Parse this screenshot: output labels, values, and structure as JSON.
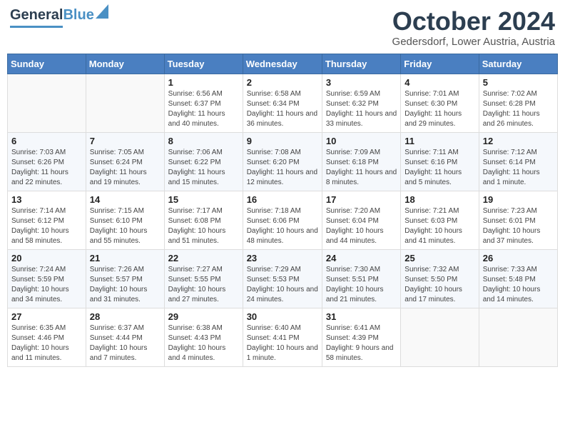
{
  "header": {
    "logo_general": "General",
    "logo_blue": "Blue",
    "month_title": "October 2024",
    "location": "Gedersdorf, Lower Austria, Austria"
  },
  "days_of_week": [
    "Sunday",
    "Monday",
    "Tuesday",
    "Wednesday",
    "Thursday",
    "Friday",
    "Saturday"
  ],
  "weeks": [
    [
      {
        "day": "",
        "sunrise": "",
        "sunset": "",
        "daylight": ""
      },
      {
        "day": "",
        "sunrise": "",
        "sunset": "",
        "daylight": ""
      },
      {
        "day": "1",
        "sunrise": "Sunrise: 6:56 AM",
        "sunset": "Sunset: 6:37 PM",
        "daylight": "Daylight: 11 hours and 40 minutes."
      },
      {
        "day": "2",
        "sunrise": "Sunrise: 6:58 AM",
        "sunset": "Sunset: 6:34 PM",
        "daylight": "Daylight: 11 hours and 36 minutes."
      },
      {
        "day": "3",
        "sunrise": "Sunrise: 6:59 AM",
        "sunset": "Sunset: 6:32 PM",
        "daylight": "Daylight: 11 hours and 33 minutes."
      },
      {
        "day": "4",
        "sunrise": "Sunrise: 7:01 AM",
        "sunset": "Sunset: 6:30 PM",
        "daylight": "Daylight: 11 hours and 29 minutes."
      },
      {
        "day": "5",
        "sunrise": "Sunrise: 7:02 AM",
        "sunset": "Sunset: 6:28 PM",
        "daylight": "Daylight: 11 hours and 26 minutes."
      }
    ],
    [
      {
        "day": "6",
        "sunrise": "Sunrise: 7:03 AM",
        "sunset": "Sunset: 6:26 PM",
        "daylight": "Daylight: 11 hours and 22 minutes."
      },
      {
        "day": "7",
        "sunrise": "Sunrise: 7:05 AM",
        "sunset": "Sunset: 6:24 PM",
        "daylight": "Daylight: 11 hours and 19 minutes."
      },
      {
        "day": "8",
        "sunrise": "Sunrise: 7:06 AM",
        "sunset": "Sunset: 6:22 PM",
        "daylight": "Daylight: 11 hours and 15 minutes."
      },
      {
        "day": "9",
        "sunrise": "Sunrise: 7:08 AM",
        "sunset": "Sunset: 6:20 PM",
        "daylight": "Daylight: 11 hours and 12 minutes."
      },
      {
        "day": "10",
        "sunrise": "Sunrise: 7:09 AM",
        "sunset": "Sunset: 6:18 PM",
        "daylight": "Daylight: 11 hours and 8 minutes."
      },
      {
        "day": "11",
        "sunrise": "Sunrise: 7:11 AM",
        "sunset": "Sunset: 6:16 PM",
        "daylight": "Daylight: 11 hours and 5 minutes."
      },
      {
        "day": "12",
        "sunrise": "Sunrise: 7:12 AM",
        "sunset": "Sunset: 6:14 PM",
        "daylight": "Daylight: 11 hours and 1 minute."
      }
    ],
    [
      {
        "day": "13",
        "sunrise": "Sunrise: 7:14 AM",
        "sunset": "Sunset: 6:12 PM",
        "daylight": "Daylight: 10 hours and 58 minutes."
      },
      {
        "day": "14",
        "sunrise": "Sunrise: 7:15 AM",
        "sunset": "Sunset: 6:10 PM",
        "daylight": "Daylight: 10 hours and 55 minutes."
      },
      {
        "day": "15",
        "sunrise": "Sunrise: 7:17 AM",
        "sunset": "Sunset: 6:08 PM",
        "daylight": "Daylight: 10 hours and 51 minutes."
      },
      {
        "day": "16",
        "sunrise": "Sunrise: 7:18 AM",
        "sunset": "Sunset: 6:06 PM",
        "daylight": "Daylight: 10 hours and 48 minutes."
      },
      {
        "day": "17",
        "sunrise": "Sunrise: 7:20 AM",
        "sunset": "Sunset: 6:04 PM",
        "daylight": "Daylight: 10 hours and 44 minutes."
      },
      {
        "day": "18",
        "sunrise": "Sunrise: 7:21 AM",
        "sunset": "Sunset: 6:03 PM",
        "daylight": "Daylight: 10 hours and 41 minutes."
      },
      {
        "day": "19",
        "sunrise": "Sunrise: 7:23 AM",
        "sunset": "Sunset: 6:01 PM",
        "daylight": "Daylight: 10 hours and 37 minutes."
      }
    ],
    [
      {
        "day": "20",
        "sunrise": "Sunrise: 7:24 AM",
        "sunset": "Sunset: 5:59 PM",
        "daylight": "Daylight: 10 hours and 34 minutes."
      },
      {
        "day": "21",
        "sunrise": "Sunrise: 7:26 AM",
        "sunset": "Sunset: 5:57 PM",
        "daylight": "Daylight: 10 hours and 31 minutes."
      },
      {
        "day": "22",
        "sunrise": "Sunrise: 7:27 AM",
        "sunset": "Sunset: 5:55 PM",
        "daylight": "Daylight: 10 hours and 27 minutes."
      },
      {
        "day": "23",
        "sunrise": "Sunrise: 7:29 AM",
        "sunset": "Sunset: 5:53 PM",
        "daylight": "Daylight: 10 hours and 24 minutes."
      },
      {
        "day": "24",
        "sunrise": "Sunrise: 7:30 AM",
        "sunset": "Sunset: 5:51 PM",
        "daylight": "Daylight: 10 hours and 21 minutes."
      },
      {
        "day": "25",
        "sunrise": "Sunrise: 7:32 AM",
        "sunset": "Sunset: 5:50 PM",
        "daylight": "Daylight: 10 hours and 17 minutes."
      },
      {
        "day": "26",
        "sunrise": "Sunrise: 7:33 AM",
        "sunset": "Sunset: 5:48 PM",
        "daylight": "Daylight: 10 hours and 14 minutes."
      }
    ],
    [
      {
        "day": "27",
        "sunrise": "Sunrise: 6:35 AM",
        "sunset": "Sunset: 4:46 PM",
        "daylight": "Daylight: 10 hours and 11 minutes."
      },
      {
        "day": "28",
        "sunrise": "Sunrise: 6:37 AM",
        "sunset": "Sunset: 4:44 PM",
        "daylight": "Daylight: 10 hours and 7 minutes."
      },
      {
        "day": "29",
        "sunrise": "Sunrise: 6:38 AM",
        "sunset": "Sunset: 4:43 PM",
        "daylight": "Daylight: 10 hours and 4 minutes."
      },
      {
        "day": "30",
        "sunrise": "Sunrise: 6:40 AM",
        "sunset": "Sunset: 4:41 PM",
        "daylight": "Daylight: 10 hours and 1 minute."
      },
      {
        "day": "31",
        "sunrise": "Sunrise: 6:41 AM",
        "sunset": "Sunset: 4:39 PM",
        "daylight": "Daylight: 9 hours and 58 minutes."
      },
      {
        "day": "",
        "sunrise": "",
        "sunset": "",
        "daylight": ""
      },
      {
        "day": "",
        "sunrise": "",
        "sunset": "",
        "daylight": ""
      }
    ]
  ]
}
